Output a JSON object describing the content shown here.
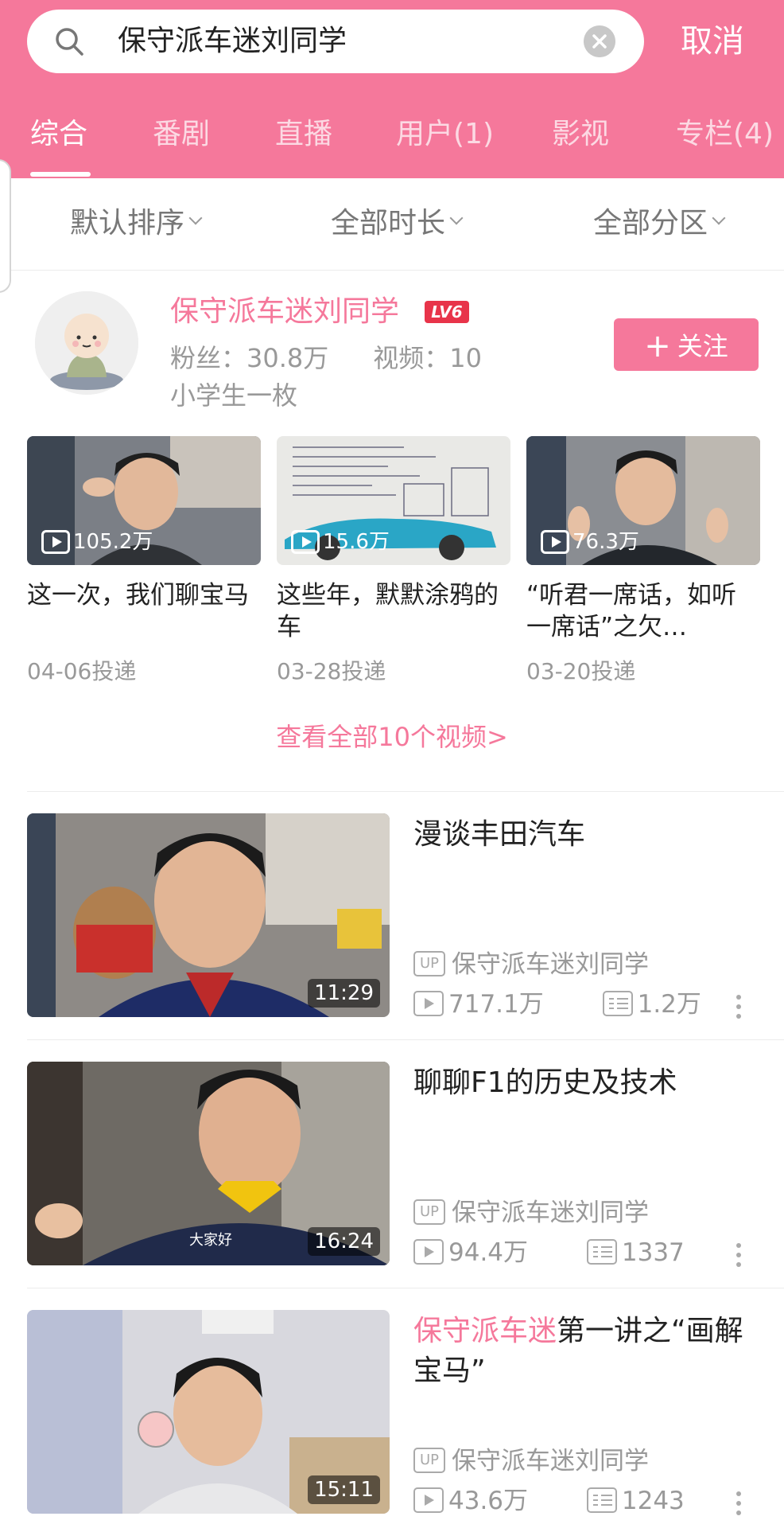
{
  "colors": {
    "brand": "#f5789b",
    "level_badge": "#e8344a",
    "muted": "#999999"
  },
  "search": {
    "query": "保守派车迷刘同学",
    "cancel_label": "取消"
  },
  "tabs": [
    {
      "label": "综合",
      "active": true
    },
    {
      "label": "番剧"
    },
    {
      "label": "直播"
    },
    {
      "label": "用户(1)"
    },
    {
      "label": "影视"
    },
    {
      "label": "专栏(4)"
    }
  ],
  "filters": [
    {
      "label": "默认排序"
    },
    {
      "label": "全部时长"
    },
    {
      "label": "全部分区"
    }
  ],
  "user": {
    "name": "保守派车迷刘同学",
    "level": "LV6",
    "fans": "粉丝：30.8万",
    "videos": "视频：10",
    "bio": "小学生一枚",
    "follow_label": "关注",
    "follow_icon": "plus-icon",
    "view_all": "查看全部10个视频>"
  },
  "user_videos": [
    {
      "views": "105.2万",
      "title": "这一次，我们聊宝马",
      "date": "04-06投递"
    },
    {
      "views": "15.6万",
      "title": "这些年，默默涂鸦的车",
      "date": "03-28投递"
    },
    {
      "views": "76.3万",
      "title": "“听君一席话，如听一席话”之欠…",
      "date": "03-20投递"
    }
  ],
  "videos": [
    {
      "title": "漫谈丰田汽车",
      "title_highlight": "",
      "up_badge": "UP",
      "uploader": "保守派车迷刘同学",
      "views": "717.1万",
      "danmaku": "1.2万",
      "duration": "11:29",
      "caption": ""
    },
    {
      "title": "聊聊F1的历史及技术",
      "title_highlight": "",
      "up_badge": "UP",
      "uploader": "保守派车迷刘同学",
      "views": "94.4万",
      "danmaku": "1337",
      "duration": "16:24",
      "caption": "大家好"
    },
    {
      "title": "第一讲之“画解宝马”",
      "title_highlight": "保守派车迷",
      "up_badge": "UP",
      "uploader": "保守派车迷刘同学",
      "views": "43.6万",
      "danmaku": "1243",
      "duration": "15:11",
      "caption": ""
    }
  ]
}
